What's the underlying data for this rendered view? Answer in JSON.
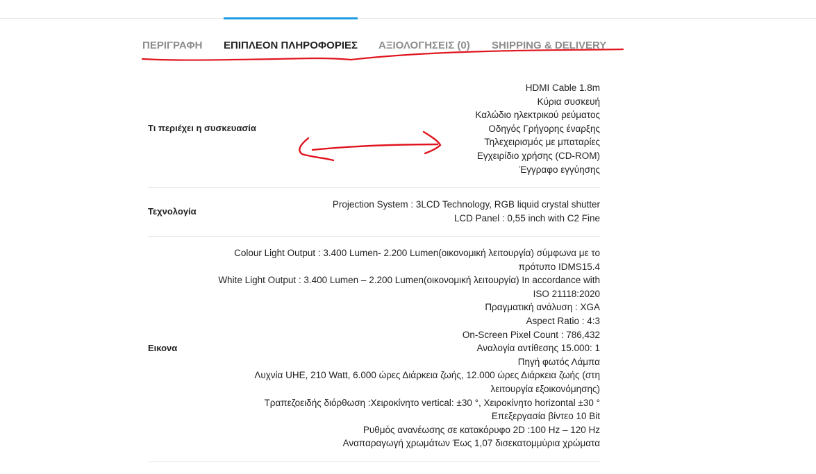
{
  "tabs": [
    {
      "label": "ΠΕΡΙΓΡΑΦΗ",
      "active": false
    },
    {
      "label": "ΕΠΙΠΛΕΟΝ ΠΛΗΡΟΦΟΡΙΕΣ",
      "active": true
    },
    {
      "label": "ΑΞΙΟΛΟΓΗΣΕΙΣ (0)",
      "active": false
    },
    {
      "label": "SHIPPING & DELIVERY",
      "active": false
    }
  ],
  "specs": [
    {
      "label": "Τι περιέχει η συσκευασία",
      "values": [
        "HDMI Cable 1.8m",
        "Κύρια συσκευή",
        "Καλώδιο ηλεκτρικού ρεύματος",
        "Οδηγός Γρήγορης έναρξης",
        "Τηλεχειρισμός με μπαταρίες",
        "Εγχειρίδιο χρήσης (CD-ROM)",
        "Έγγραφο εγγύησης"
      ]
    },
    {
      "label": "Τεχνολογία",
      "values": [
        "Projection System : 3LCD Technology, RGB liquid crystal shutter",
        "LCD Panel : 0,55 inch with C2 Fine"
      ]
    },
    {
      "label": "Εικονα",
      "values": [
        "Colour Light Output : 3.400 Lumen- 2.200 Lumen(οικονομική λειτουργία) σύμφωνα με το",
        "πρότυπο IDMS15.4",
        "White Light Output : 3.400 Lumen – 2.200 Lumen(οικονομική λειτουργία) In accordance with",
        "ISO 21118:2020",
        "Πραγματική ανάλυση : XGA",
        "Aspect Ratio : 4:3",
        "On-Screen Pixel Count : 786,432",
        "Αναλογία αντίθεσης 15.000: 1",
        "Πηγή φωτός Λάμπα",
        "Λυχνία UHE, 210 Watt, 6.000 ώρες Διάρκεια ζωής, 12.000 ώρες Διάρκεια ζωής (στη",
        "λειτουργία εξοικονόμησης)",
        "Τραπεζοειδής διόρθωση :Χειροκίνητο vertical: ±30 °, Χειροκίνητο horizontal ±30 °",
        "Επεξεργασία βίντεο 10 Bit",
        "Ρυθμός ανανέωσης σε κατακόρυφο 2D :100 Hz – 120 Hz",
        "Αναπαραγωγή χρωμάτων Έως 1,07 δισεκατομμύρια χρώματα"
      ]
    }
  ],
  "colors": {
    "accent": "#1e9be0",
    "annotation": "#e0141e",
    "tab_inactive": "#8c8c8c",
    "text": "#222222"
  }
}
